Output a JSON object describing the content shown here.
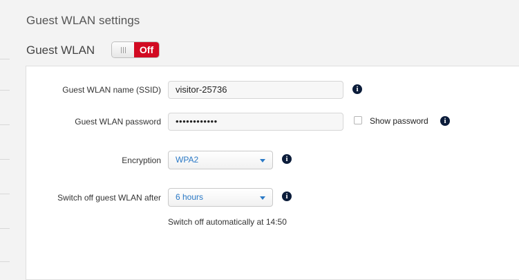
{
  "page": {
    "title": "Guest WLAN settings"
  },
  "guest_wlan": {
    "label": "Guest WLAN",
    "toggle_state": "Off"
  },
  "form": {
    "ssid": {
      "label": "Guest WLAN name (SSID)",
      "value": "visitor-25736"
    },
    "password": {
      "label": "Guest WLAN password",
      "value": "••••••••••••"
    },
    "show_password": {
      "label": "Show password",
      "checked": false
    },
    "encryption": {
      "label": "Encryption",
      "value": "WPA2"
    },
    "switch_off": {
      "label": "Switch off guest WLAN after",
      "value": "6 hours",
      "hint": "Switch off automatically at 14:50"
    }
  },
  "icons": {
    "info": "info-icon",
    "dropdown": "chevron-down-icon"
  },
  "colors": {
    "toggle_off": "#d20a22",
    "select_text": "#2a79c6",
    "info_icon": "#0b1c3a"
  }
}
